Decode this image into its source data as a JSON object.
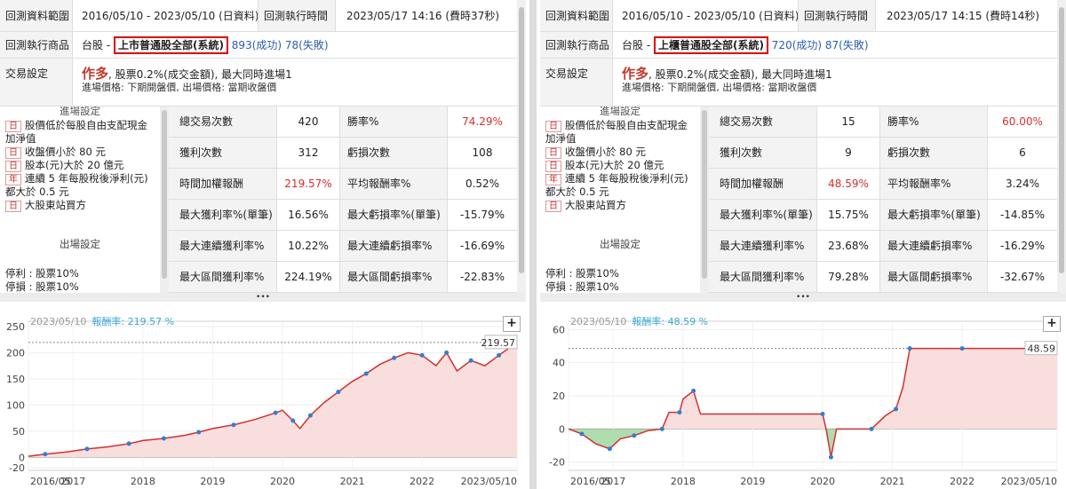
{
  "left": {
    "range_label": "回測資料範圍",
    "range_value": "2016/05/10 - 2023/05/10 (日資料)",
    "exec_time_label": "回測執行時間",
    "exec_time_value": "2023/05/17 14:16 (費時37秒)",
    "product_label": "回測執行商品",
    "market": "台股 -",
    "product": "上市普通股全部(系統)",
    "success": "893(成功)",
    "fail": "78(失敗)",
    "trade_label": "交易設定",
    "direction": "作多",
    "trade_line1": ", 股票0.2%(成交金額), 最大同時進場1",
    "trade_line2": "進場價格: 下期開盤價, 出場價格: 當期收盤價",
    "entry_head": "進場設定",
    "conditions": [
      {
        "tag": "日",
        "text": "股價低於每股自由支配現金加淨值"
      },
      {
        "tag": "日",
        "text": "收盤價小於 80 元"
      },
      {
        "tag": "日",
        "text": "股本(元)大於 20 億元"
      },
      {
        "tag": "年",
        "text": "連續 5 年每股稅後淨利(元)都大於 0.5 元"
      },
      {
        "tag": "日",
        "text": "大股東站買方"
      }
    ],
    "exit_head": "出場設定",
    "exit_profit": "停利 : 股票10%",
    "exit_loss": "停損 : 股票10%",
    "stats": [
      [
        "總交易次數",
        "420",
        "勝率%",
        "74.29%"
      ],
      [
        "獲利次數",
        "312",
        "虧損次數",
        "108"
      ],
      [
        "時間加權報酬",
        "219.57%",
        "平均報酬率%",
        "0.52%"
      ],
      [
        "最大獲利率%(單筆)",
        "16.56%",
        "最大虧損率%(單筆)",
        "-15.79%"
      ],
      [
        "最大連續獲利率%",
        "10.22%",
        "最大連續虧損率%",
        "-16.69%"
      ],
      [
        "最大區間獲利率%",
        "224.19%",
        "最大區間虧損率%",
        "-22.83%"
      ]
    ],
    "chart_date": "2023/05/10",
    "chart_ret_label": "報酬率: 219.57 %",
    "chart_end_label": "219.57",
    "chart_end_date": "2023/05/10"
  },
  "right": {
    "range_label": "回測資料範圍",
    "range_value": "2016/05/10 - 2023/05/10 (日資料)",
    "exec_time_label": "回測執行時間",
    "exec_time_value": "2023/05/17 14:15 (費時14秒)",
    "product_label": "回測執行商品",
    "market": "台股 -",
    "product": "上櫃普通股全部(系統)",
    "success": "720(成功)",
    "fail": "87(失敗)",
    "trade_label": "交易設定",
    "direction": "作多",
    "trade_line1": ", 股票0.2%(成交金額), 最大同時進場1",
    "trade_line2": "進場價格: 下期開盤價, 出場價格: 當期收盤價",
    "entry_head": "進場設定",
    "conditions": [
      {
        "tag": "日",
        "text": "股價低於每股自由支配現金加淨值"
      },
      {
        "tag": "日",
        "text": "收盤價小於 80 元"
      },
      {
        "tag": "日",
        "text": "股本(元)大於 20 億元"
      },
      {
        "tag": "年",
        "text": "連續 5 年每股稅後淨利(元)都大於 0.5 元"
      },
      {
        "tag": "日",
        "text": "大股東站買方"
      }
    ],
    "exit_head": "出場設定",
    "exit_profit": "停利 : 股票10%",
    "exit_loss": "停損 : 股票10%",
    "stats": [
      [
        "總交易次數",
        "15",
        "勝率%",
        "60.00%"
      ],
      [
        "獲利次數",
        "9",
        "虧損次數",
        "6"
      ],
      [
        "時間加權報酬",
        "48.59%",
        "平均報酬率%",
        "3.24%"
      ],
      [
        "最大獲利率%(單筆)",
        "15.75%",
        "最大虧損率%(單筆)",
        "-14.85%"
      ],
      [
        "最大連續獲利率%",
        "23.68%",
        "最大連續虧損率%",
        "-16.29%"
      ],
      [
        "最大區間獲利率%",
        "79.28%",
        "最大區間虧損率%",
        "-32.67%"
      ]
    ],
    "chart_date": "2023/05/10",
    "chart_ret_label": "報酬率: 48.59 %",
    "chart_end_label": "48.59",
    "chart_end_date": "2023/05/10"
  },
  "colors": {
    "line": "#d32f2f",
    "fill": "#f9dede",
    "marker": "#2f7fd1",
    "loss_fill": "#9bd49b",
    "loss_line": "#2ca02c"
  },
  "chart_data": [
    {
      "type": "area",
      "x": [
        2016.36,
        2016.6,
        2016.9,
        2017.2,
        2017.5,
        2017.8,
        2018.0,
        2018.3,
        2018.6,
        2018.8,
        2019.0,
        2019.3,
        2019.6,
        2019.9,
        2020.0,
        2020.15,
        2020.25,
        2020.4,
        2020.6,
        2020.8,
        2021.0,
        2021.2,
        2021.4,
        2021.6,
        2021.8,
        2022.0,
        2022.2,
        2022.35,
        2022.5,
        2022.7,
        2022.9,
        2023.1,
        2023.36
      ],
      "y": [
        2,
        6,
        10,
        16,
        20,
        26,
        32,
        36,
        42,
        48,
        55,
        62,
        72,
        85,
        90,
        70,
        55,
        80,
        105,
        125,
        145,
        160,
        178,
        190,
        200,
        195,
        175,
        200,
        165,
        185,
        175,
        195,
        219.57
      ],
      "ylim": [
        -25,
        260
      ],
      "yticks": [
        -20,
        0,
        50,
        100,
        150,
        200,
        250
      ],
      "xticks": [
        "2016/05",
        "2017",
        "2018",
        "2019",
        "2020",
        "2021",
        "2022",
        "2023/05/10"
      ],
      "xlim": [
        2016.36,
        2023.36
      ]
    },
    {
      "type": "area",
      "x": [
        2016.36,
        2016.55,
        2016.75,
        2016.95,
        2017.1,
        2017.3,
        2017.5,
        2017.7,
        2017.8,
        2017.95,
        2018.0,
        2018.15,
        2018.25,
        2020.0,
        2020.05,
        2020.12,
        2020.2,
        2020.7,
        2020.9,
        2021.05,
        2021.15,
        2021.25,
        2021.5,
        2022.0,
        2022.5,
        2023.0,
        2023.36
      ],
      "y": [
        0,
        -3,
        -9,
        -12,
        -6,
        -4,
        -1,
        0,
        10,
        10,
        18,
        23,
        9,
        9,
        0,
        -17,
        0,
        0,
        8,
        12,
        25,
        48.59,
        48.59,
        48.59,
        48.59,
        48.59,
        48.59
      ],
      "ylim": [
        -25,
        65
      ],
      "yticks": [
        -20,
        0,
        20,
        40,
        60
      ],
      "xticks": [
        "2016/05",
        "2017",
        "2018",
        "2019",
        "2020",
        "2021",
        "2022",
        "2023/05/10"
      ],
      "xlim": [
        2016.36,
        2023.36
      ]
    }
  ]
}
